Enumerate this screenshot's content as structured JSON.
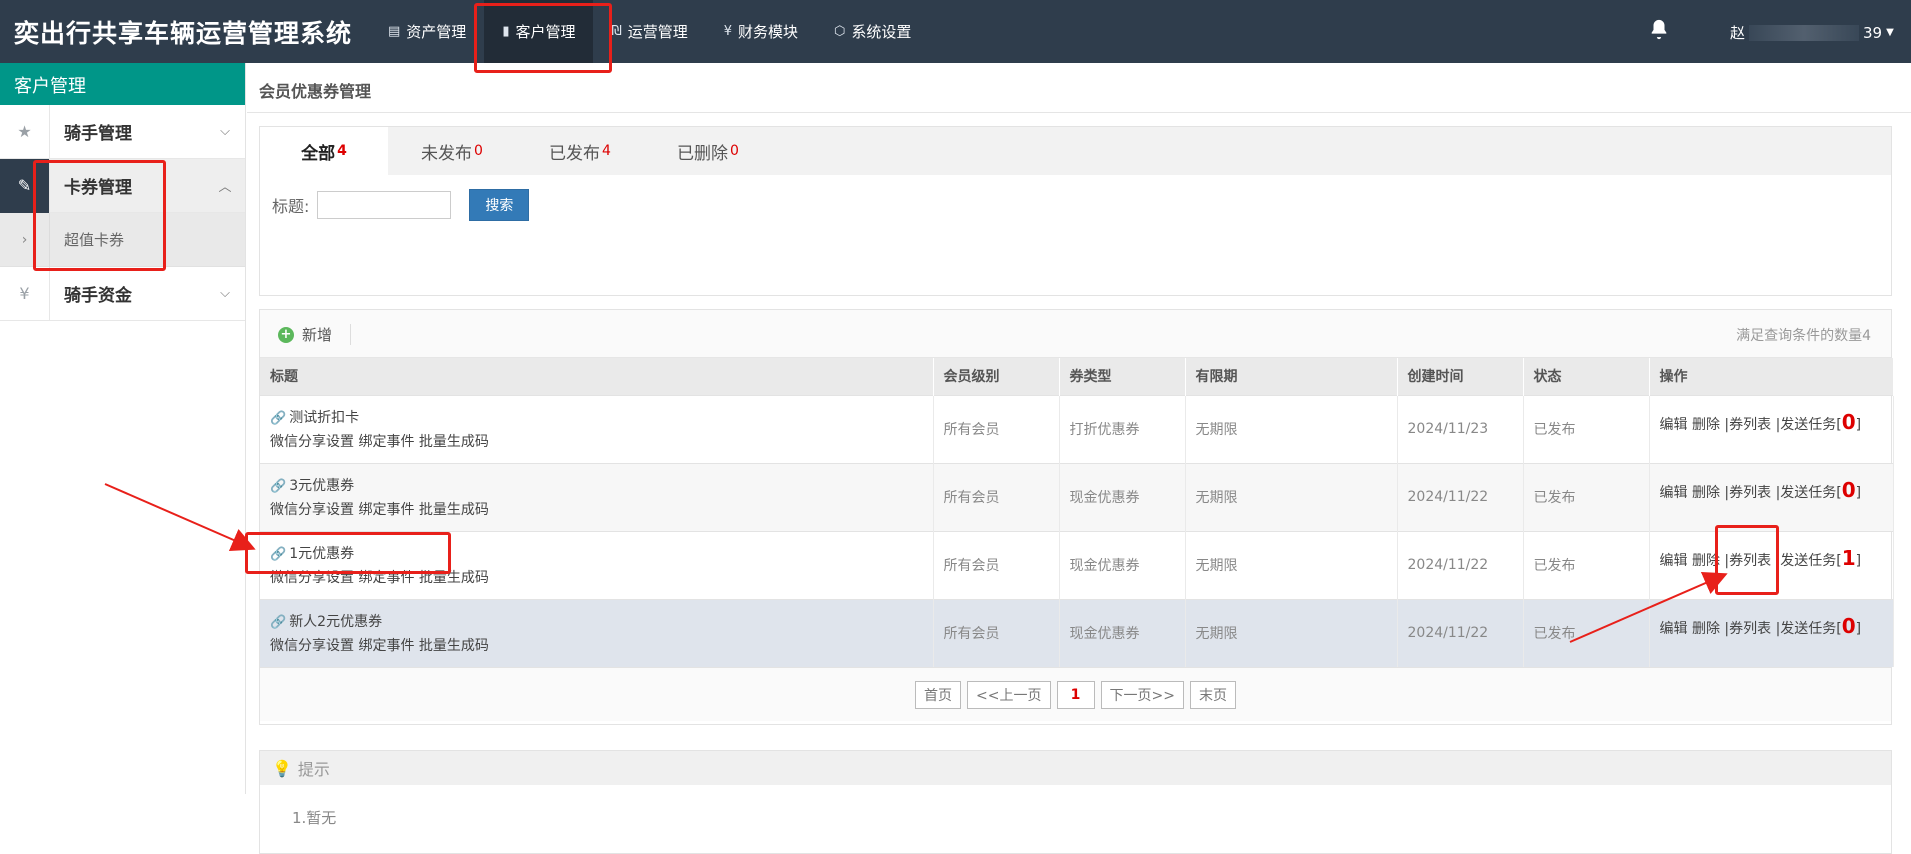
{
  "header": {
    "brand": "奕出行共享车辆运营管理系统",
    "nav": [
      {
        "icon": "▤",
        "label": "资产管理"
      },
      {
        "icon": "▮",
        "label": "客户管理"
      },
      {
        "icon": "₪",
        "label": "运营管理"
      },
      {
        "icon": "¥",
        "label": "财务模块"
      },
      {
        "icon": "⬡",
        "label": "系统设置"
      }
    ],
    "user_prefix": "赵",
    "user_suffix": "39"
  },
  "sidebar": {
    "title": "客户管理",
    "items": [
      {
        "icon": "★",
        "label": "骑手管理",
        "chev": "⌵"
      },
      {
        "icon": "✎",
        "label": "卡券管理",
        "chev": "︿"
      },
      {
        "icon": "¥",
        "label": "骑手资金",
        "chev": "⌵"
      }
    ],
    "sub": {
      "icon": "›",
      "label": "超值卡券"
    }
  },
  "page": {
    "title": "会员优惠券管理",
    "tabs": [
      {
        "label": "全部",
        "count": "4"
      },
      {
        "label": "未发布",
        "count": "0"
      },
      {
        "label": "已发布",
        "count": "4"
      },
      {
        "label": "已删除",
        "count": "0"
      }
    ],
    "search": {
      "label": "标题:",
      "value": "",
      "button": "搜索"
    },
    "toolbar": {
      "add": "新增",
      "match": "满足查询条件的数量4"
    },
    "columns": [
      "标题",
      "会员级别",
      "券类型",
      "有限期",
      "创建时间",
      "状态",
      "操作"
    ],
    "rows": [
      {
        "title": "测试折扣卡",
        "links": "微信分享设置 绑定事件 批量生成码",
        "level": "所有会员",
        "type": "打折优惠券",
        "period": "无期限",
        "created": "2024/11/23",
        "status": "已发布",
        "ops": "编辑 删除 |券列表 |发送任务[",
        "ops_count": "0",
        "ops_end": "]"
      },
      {
        "title": "3元优惠券",
        "links": "微信分享设置 绑定事件 批量生成码",
        "level": "所有会员",
        "type": "现金优惠券",
        "period": "无期限",
        "created": "2024/11/22",
        "status": "已发布",
        "ops": "编辑 删除 |券列表 |发送任务[",
        "ops_count": "0",
        "ops_end": "]"
      },
      {
        "title": "1元优惠券",
        "links": "微信分享设置 绑定事件 批量生成码",
        "level": "所有会员",
        "type": "现金优惠券",
        "period": "无期限",
        "created": "2024/11/22",
        "status": "已发布",
        "ops": "编辑 删除 |券列表 |发送任务[",
        "ops_count": "1",
        "ops_end": "]"
      },
      {
        "title": "新人2元优惠券",
        "links": "微信分享设置 绑定事件 批量生成码",
        "level": "所有会员",
        "type": "现金优惠券",
        "period": "无期限",
        "created": "2024/11/22",
        "status": "已发布",
        "ops": "编辑 删除 |券列表 |发送任务[",
        "ops_count": "0",
        "ops_end": "]"
      }
    ],
    "pager": {
      "first": "首页",
      "prev": "<<上一页",
      "current": "1",
      "next": "下一页>>",
      "last": "末页"
    },
    "tip": {
      "title": "提示",
      "body": "1.暂无"
    }
  },
  "colors": {
    "topbar": "#2f3d4c",
    "accent": "#009688",
    "annotation": "#e8201a"
  }
}
